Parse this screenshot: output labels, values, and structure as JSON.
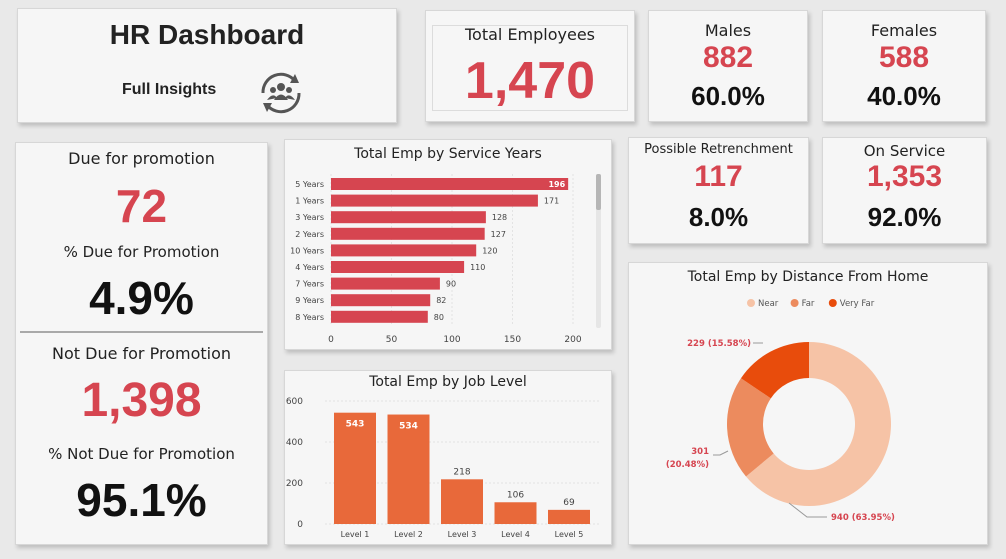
{
  "header": {
    "title": "HR Dashboard",
    "subtitle": "Full Insights",
    "icon": "team-refresh-icon"
  },
  "total_employees": {
    "label": "Total Employees",
    "value": "1,470"
  },
  "males": {
    "label": "Males",
    "value": "882",
    "pct": "60.0%"
  },
  "females": {
    "label": "Females",
    "value": "588",
    "pct": "40.0%"
  },
  "retrenchment": {
    "label": "Possible Retrenchment",
    "value": "117",
    "pct": "8.0%"
  },
  "on_service": {
    "label": "On Service",
    "value": "1,353",
    "pct": "92.0%"
  },
  "due": {
    "label": "Due for promotion",
    "value": "72",
    "pct_label": "% Due for Promotion",
    "pct": "4.9%"
  },
  "not_due": {
    "label": "Not Due for Promotion",
    "value": "1,398",
    "pct_label": "% Not Due for Promotion",
    "pct": "95.1%"
  },
  "colors": {
    "accent_red": "#d64550",
    "bar_orange": "#e8693a",
    "near": "#f6c3a6",
    "far": "#ec8b5e",
    "very_far": "#e84c0c"
  },
  "chart_data": [
    {
      "type": "bar",
      "orientation": "horizontal",
      "title": "Total Emp by Service Years",
      "categories": [
        "5 Years",
        "1 Years",
        "3 Years",
        "2 Years",
        "10 Years",
        "4 Years",
        "7 Years",
        "9 Years",
        "8 Years"
      ],
      "values": [
        196,
        171,
        128,
        127,
        120,
        110,
        90,
        82,
        80
      ],
      "x_ticks": [
        "0",
        "50",
        "100",
        "150",
        "200"
      ],
      "xlim": [
        0,
        200
      ],
      "grid": true,
      "color": "#d64550"
    },
    {
      "type": "bar",
      "title": "Total Emp by Job Level",
      "categories": [
        "Level 1",
        "Level 2",
        "Level 3",
        "Level 4",
        "Level 5"
      ],
      "values": [
        543,
        534,
        218,
        106,
        69
      ],
      "y_ticks": [
        "0",
        "200",
        "400",
        "600"
      ],
      "ylim": [
        0,
        600
      ],
      "grid": true,
      "color": "#e8693a"
    },
    {
      "type": "pie",
      "donut": true,
      "title": "Total Emp by Distance From Home",
      "legend_position": "top",
      "series": [
        {
          "name": "Near",
          "value": 940,
          "label": "940 (63.95%)",
          "color": "#f6c3a6"
        },
        {
          "name": "Far",
          "value": 301,
          "label": "301 (20.48%)",
          "color": "#ec8b5e"
        },
        {
          "name": "Very Far",
          "value": 229,
          "label": "229 (15.58%)",
          "color": "#e84c0c"
        }
      ]
    }
  ]
}
